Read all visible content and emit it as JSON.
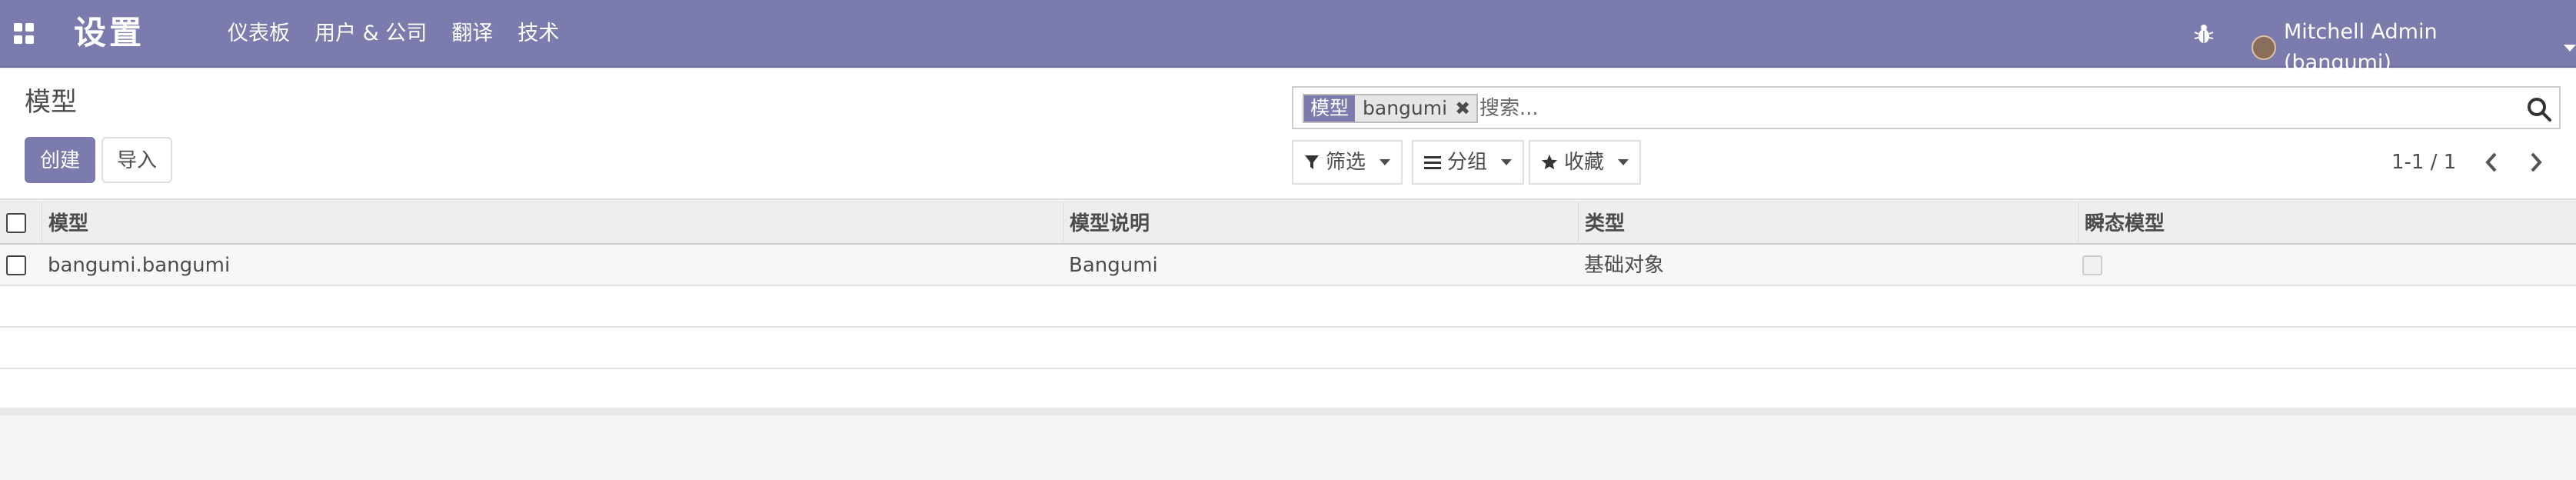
{
  "navbar": {
    "app_title": "设置",
    "menu": [
      "仪表板",
      "用户 & 公司",
      "翻译",
      "技术"
    ],
    "user_name": "Mitchell Admin (bangumi)"
  },
  "control_panel": {
    "breadcrumb": "模型",
    "create_label": "创建",
    "import_label": "导入",
    "search": {
      "facet_key": "模型",
      "facet_value": "bangumi",
      "facet_remove": "✖",
      "placeholder": "搜索..."
    },
    "filters_label": "筛选",
    "groupby_label": "分组",
    "favorites_label": "收藏",
    "pager_text": "1-1 / 1"
  },
  "table": {
    "columns": [
      "模型",
      "模型说明",
      "类型",
      "瞬态模型"
    ],
    "rows": [
      {
        "model": "bangumi.bangumi",
        "description": "Bangumi",
        "type": "基础对象",
        "transient": false
      }
    ]
  },
  "colors": {
    "brand": "#7c7bad",
    "navbar_text": "#ffffff"
  }
}
